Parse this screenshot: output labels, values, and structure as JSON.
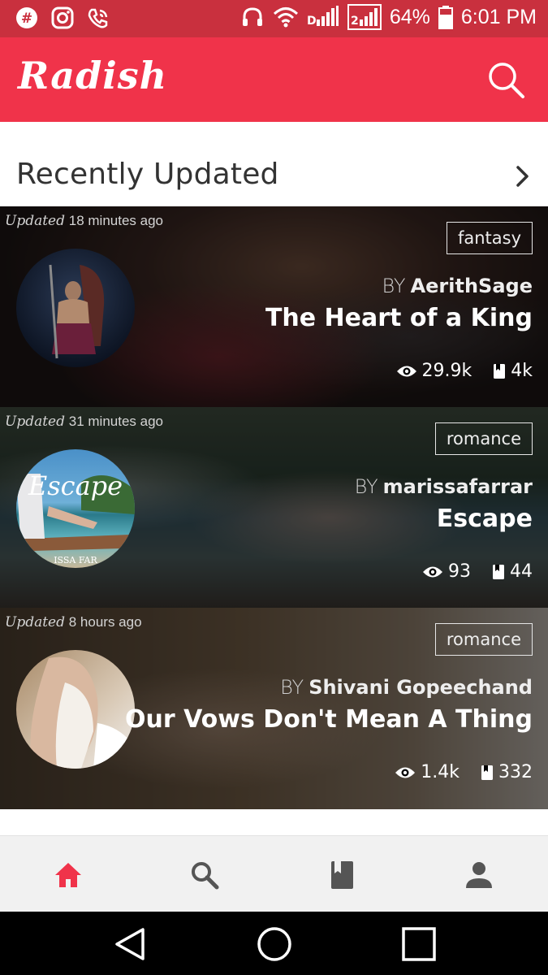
{
  "status_bar": {
    "battery": "64%",
    "time": "6:01 PM",
    "left_icons": [
      "hashtag-icon",
      "instagram-icon",
      "wifi-call-icon"
    ],
    "right_icons": [
      "headphones-icon",
      "wifi-icon",
      "signal-icon",
      "signal-2-icon",
      "battery-icon"
    ]
  },
  "app_bar": {
    "logo": "Radish",
    "color": "#f0334a"
  },
  "section": {
    "title": "Recently Updated"
  },
  "stories": [
    {
      "updated_label": "Updated",
      "updated_time": "18 minutes ago",
      "genre": "fantasy",
      "by": "BY",
      "author": "AerithSage",
      "title": "The Heart of a King",
      "views": "29.9k",
      "chapters": "4k"
    },
    {
      "updated_label": "Updated",
      "updated_time": "31 minutes ago",
      "genre": "romance",
      "by": "BY",
      "author": "marissafarrar",
      "title": "Escape",
      "views": "93",
      "chapters": "44",
      "cover_text": "Escape",
      "cover_subtext": "ISSA FAR"
    },
    {
      "updated_label": "Updated",
      "updated_time": "8 hours ago",
      "genre": "romance",
      "by": "BY",
      "author": "Shivani Gopeechand",
      "title": "Our Vows Don't Mean A Thing",
      "views": "1.4k",
      "chapters": "332"
    }
  ],
  "bottom_nav": {
    "items": [
      "home-icon",
      "search-icon",
      "library-icon",
      "profile-icon"
    ],
    "active": "home-icon",
    "active_color": "#f0334a",
    "inactive_color": "#555555"
  },
  "system_nav": [
    "back-icon",
    "home-circle-icon",
    "recents-icon"
  ]
}
